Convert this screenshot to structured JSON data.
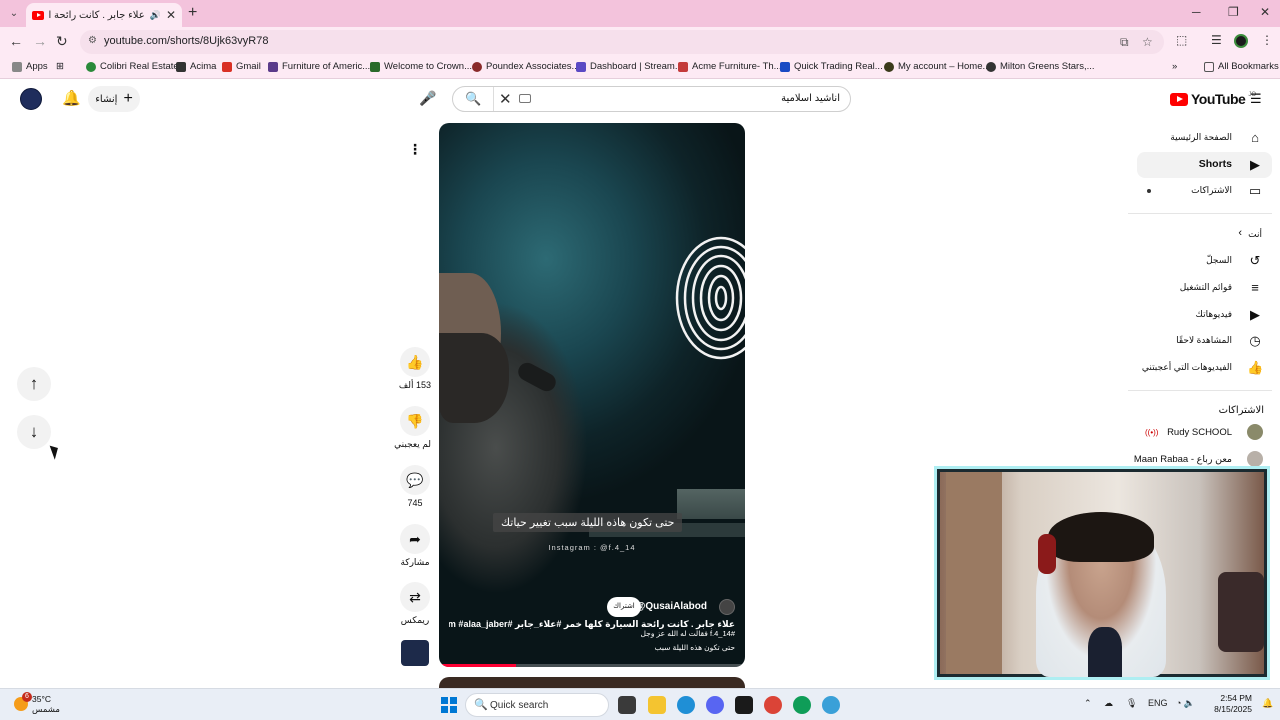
{
  "browser": {
    "tab_title": "علاء جابر . كانت رائحة السيارة",
    "url": "youtube.com/shorts/8Ujk63vyR78",
    "bookmarks": [
      {
        "label": "Apps",
        "color": "#555555"
      },
      {
        "label": "Colibri Real Estate",
        "color": "#2a8a3a"
      },
      {
        "label": "Acima",
        "color": "#333333"
      },
      {
        "label": "Gmail",
        "color": "#d93025"
      },
      {
        "label": "Furniture of Americ...",
        "color": "#5a3b8a"
      },
      {
        "label": "Welcome to Crown...",
        "color": "#2a6a2a"
      },
      {
        "label": "Poundex Associates...",
        "color": "#8a2a2a"
      },
      {
        "label": "Dashboard | Stream...",
        "color": "#5b4ac4"
      },
      {
        "label": "Acme Furniture- Th...",
        "color": "#c43b3b"
      },
      {
        "label": "Quick Trading Real...",
        "color": "#1a4ac4"
      },
      {
        "label": "My account – Home...",
        "color": "#3a3a1a"
      },
      {
        "label": "Milton Greens Stars,...",
        "color": "#333333"
      }
    ],
    "all_bookmarks": "All Bookmarks"
  },
  "youtube": {
    "create_label": "إنشاء",
    "search_value": "اناشيد اسلامية",
    "logo_text": "YouTube",
    "logo_sup": "JO",
    "guide": {
      "home": "الصفحة الرئيسية",
      "shorts": "Shorts",
      "subscriptions": "الاشتراكات",
      "you": "أنت",
      "history": "السجلّ",
      "playlists": "قوائم التشغيل",
      "your_videos": "فيديوهاتك",
      "watch_later": "المشاهدة لاحقًا",
      "liked": "الفيديوهات التي أعجبتني",
      "subs_header": "الاشتراكات",
      "sub1": "Rudy SCHOOL",
      "sub2": "معن رباع - Maan Rabaa"
    },
    "video": {
      "caption": "حتى تكون هاذه الليلة سبب تغيير حياتك",
      "instagram": "Instagram : @f.4_14",
      "channel": "@QusaiAlabod",
      "subscribe": "اشتراك",
      "desc1": "علاء جابر . كانت رائحة السيارة كلها خمر #علاء_جابر #Instagram #alaa_jaber",
      "desc2": "#f.4_14 فقالت له الله عز وجل",
      "desc3": "حتى تكون هذه الليلة سبب",
      "progress": 0.25
    },
    "actions": {
      "likes": "153 ألف",
      "dislike": "لم يعجبني",
      "comments": "745",
      "share": "مشاركة",
      "remix": "ريمكس"
    }
  },
  "taskbar": {
    "temp": "35°C",
    "weather": "مشمس",
    "badge": "6",
    "search": "Quick search",
    "lang": "ENG",
    "time": "2:54 PM",
    "date": "8/15/2025"
  }
}
